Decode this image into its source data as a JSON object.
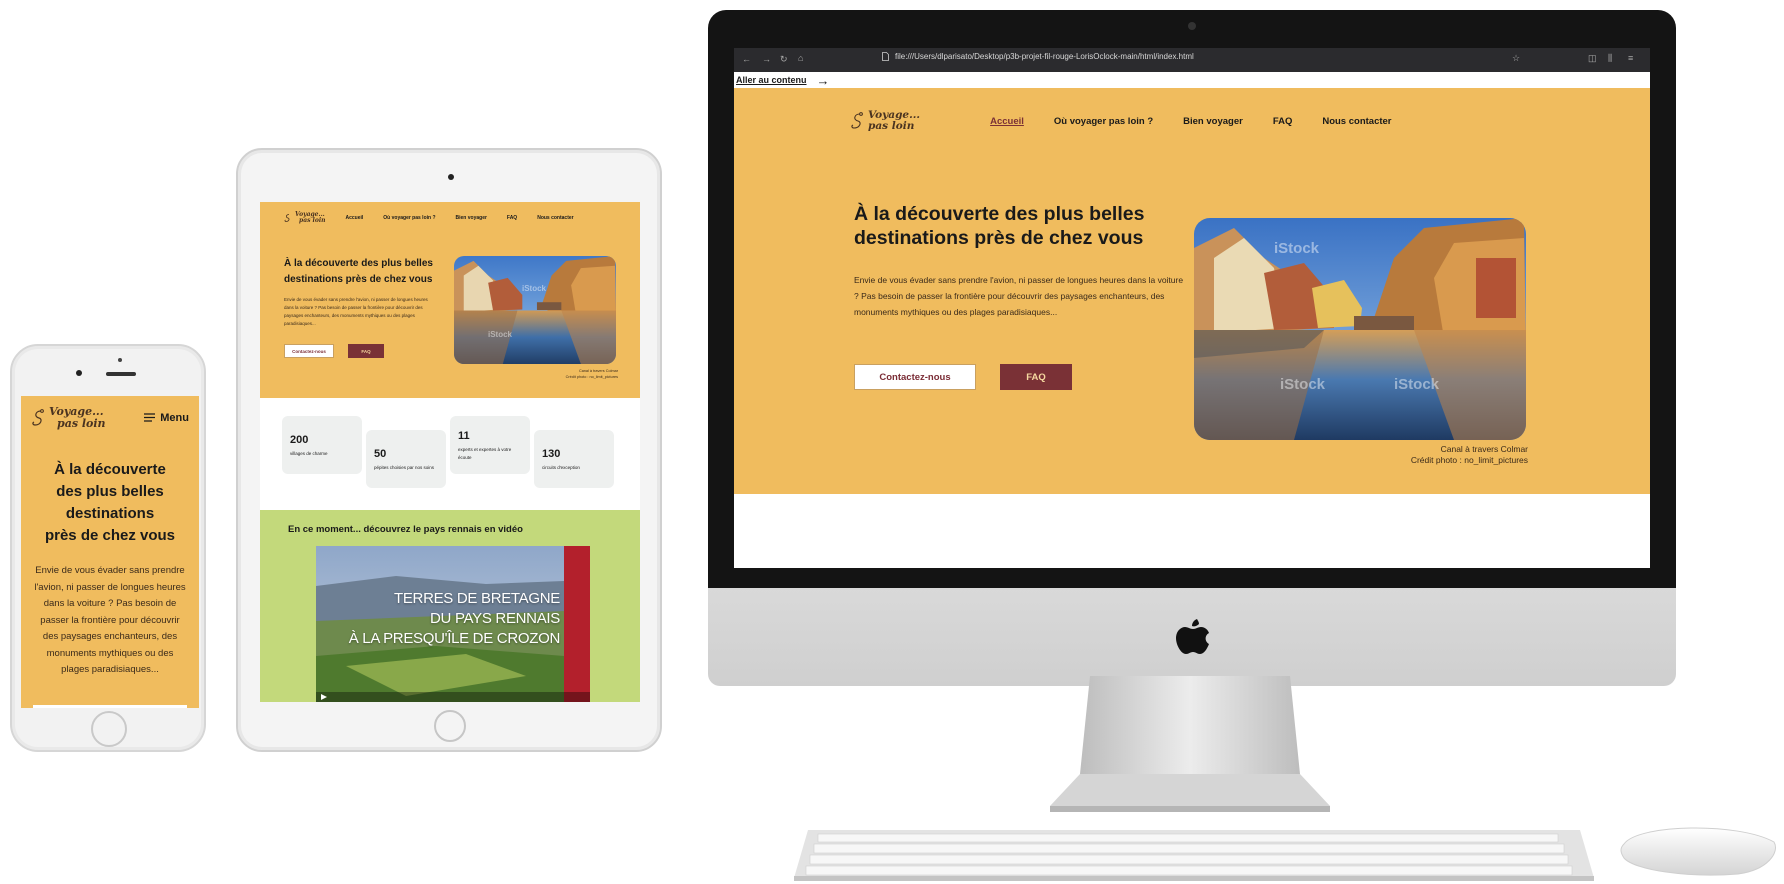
{
  "site": {
    "logo_line1": "Voyage...",
    "logo_line2": "pas loin",
    "menu_label": "Menu",
    "nav": [
      "Accueil",
      "Où voyager pas loin ?",
      "Bien voyager",
      "FAQ",
      "Nous contacter"
    ],
    "headline": "À la découverte des plus belles destinations près de chez vous",
    "phone_headline_lines": [
      "À la découverte",
      "des plus belles",
      "destinations",
      "près de chez vous"
    ],
    "intro": "Envie de vous évader sans prendre l'avion, ni passer de longues heures dans la voiture ? Pas besoin de passer la frontière pour découvrir des paysages enchanteurs, des monuments mythiques ou des plages paradisiaques...",
    "btn_contact": "Contactez-nous",
    "btn_faq": "FAQ",
    "photo_caption_1": "Canal à travers Colmar",
    "photo_caption_2": "Crédit photo : no_limit_pictures",
    "photo_watermark": "iStock",
    "stats": [
      {
        "value": "200",
        "label": "villages de charme"
      },
      {
        "value": "50",
        "label": "pépites choisies par nos soins"
      },
      {
        "value": "11",
        "label": "experts et expertes à votre écoute"
      },
      {
        "value": "130",
        "label": "circuits d'exception"
      }
    ],
    "video_heading": "En ce moment... découvrez le pays rennais en vidéo",
    "video_title_lines": [
      "TERRES DE BRETAGNE",
      "DU PAYS RENNAIS",
      "À LA PRESQU'ÎLE DE CROZON"
    ]
  },
  "browser": {
    "url": "file:///Users/dlparisato/Desktop/p3b-projet-fil-rouge-LorisOclock-main/html/index.html",
    "skip_link": "Aller au contenu",
    "skip_arrow": "→"
  },
  "colors": {
    "sand": "#f0bc5e",
    "burgundy": "#7a3136",
    "green": "#c3d97b",
    "stat_bg": "#eef0ef"
  }
}
